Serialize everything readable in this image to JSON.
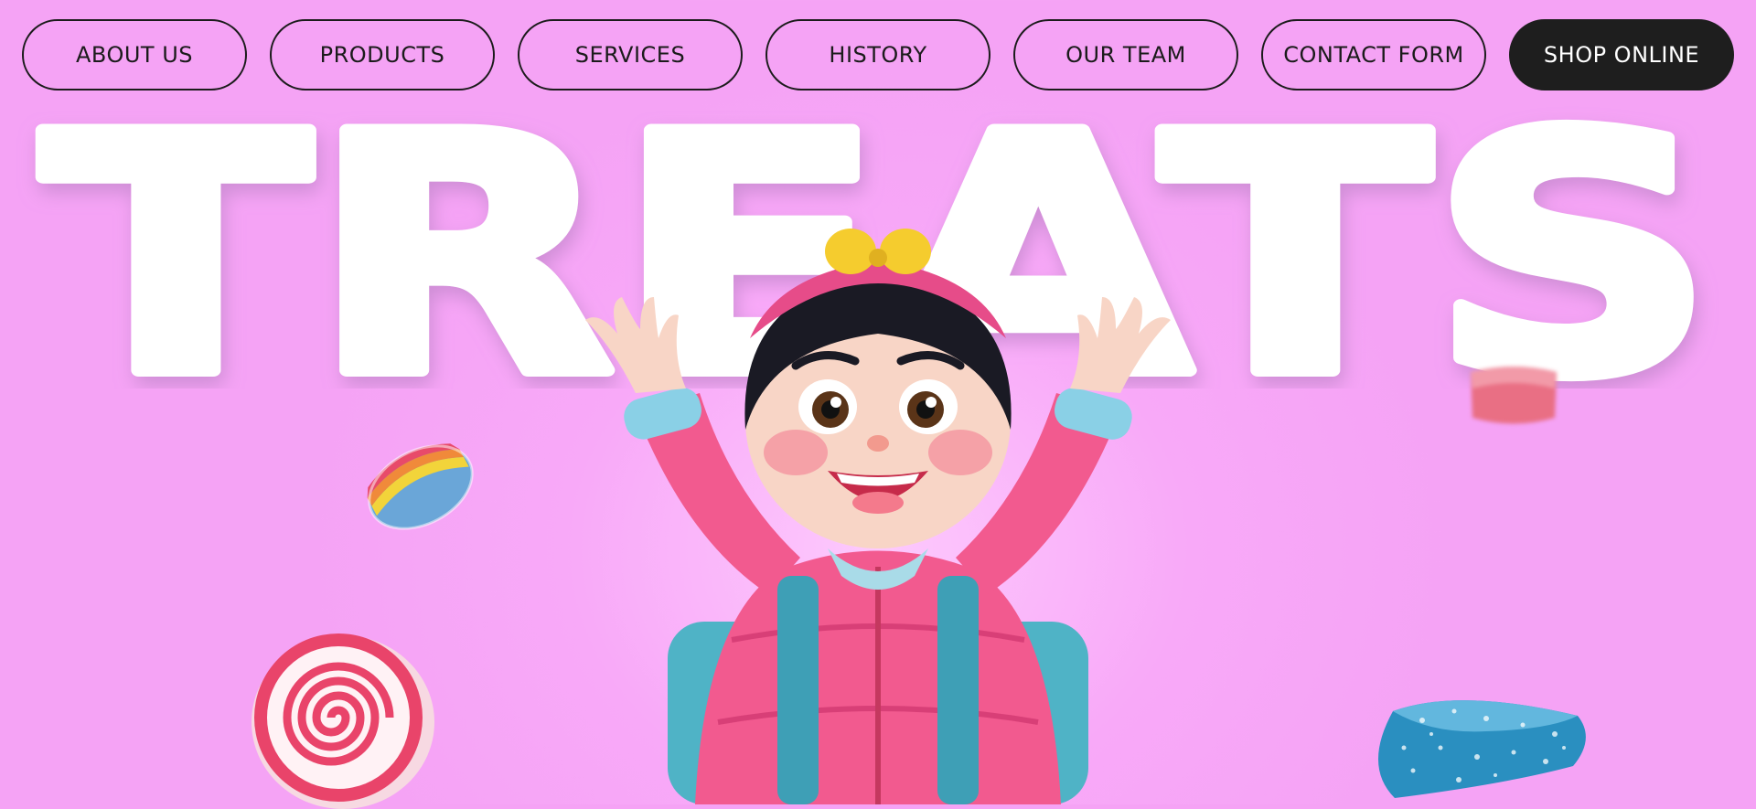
{
  "nav": {
    "items": [
      {
        "label": "ABOUT US"
      },
      {
        "label": "PRODUCTS"
      },
      {
        "label": "SERVICES"
      },
      {
        "label": "HISTORY"
      },
      {
        "label": "OUR TEAM"
      },
      {
        "label": "CONTACT FORM"
      }
    ],
    "cta": {
      "label": "SHOP ONLINE"
    }
  },
  "hero": {
    "title": "TREATS",
    "illustration": "cheerful-girl-in-pink-puffer-jacket",
    "decorations": [
      "rainbow-gummy-candy",
      "pink-spiral-candy",
      "red-gummy-candy",
      "blue-sugared-gummy-candy"
    ]
  },
  "colors": {
    "background": "#f5a3f5",
    "text": "#1b1b1b",
    "cta_background": "#1e1e1e",
    "cta_text": "#ffffff",
    "title": "#ffffff",
    "title_shadow": "#c88ad0"
  }
}
